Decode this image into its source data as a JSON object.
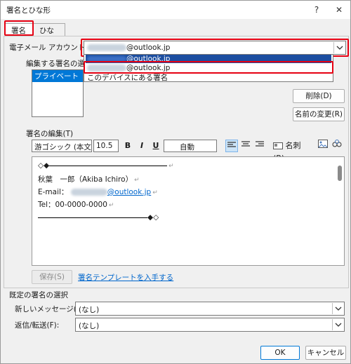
{
  "window": {
    "title": "署名とひな形",
    "help": "?",
    "close": "✕"
  },
  "tabs": [
    {
      "label": "署名"
    },
    {
      "label": "ひな形"
    }
  ],
  "account": {
    "label": "電子メール アカウント(A):",
    "value_suffix": "@outlook.jp",
    "dropdown_items": [
      "@outlook.jp",
      "@outlook.jp",
      "このデバイスにある署名"
    ]
  },
  "signature_select": {
    "label": "編集する署名の選択(",
    "items": [
      "プライベート"
    ]
  },
  "buttons": {
    "delete": "削除(D)",
    "rename": "名前の変更(R)",
    "save": "保存(S)",
    "ok": "OK",
    "cancel": "キャンセル",
    "business_card": "名刺(B)"
  },
  "editor": {
    "label": "署名の編集(T)",
    "font": "游ゴシック (本文の",
    "size": "10.5",
    "color": "自動",
    "lines": {
      "top": "◇◆",
      "name": "秋葉　一郎（Akiba Ichiro）",
      "email_label": "E-mail：",
      "email_domain": "@outlook.jp",
      "tel": "Tel：00-0000-0000",
      "bottom": "◆◇"
    },
    "return_mark": "↵"
  },
  "template_link": "署名テンプレートを入手する",
  "defaults": {
    "section_label": "既定の署名の選択",
    "new_message_label": "新しいメッセージ(M):",
    "new_message_value": "(なし)",
    "reply_label": "返信/転送(F):",
    "reply_value": "(なし)"
  },
  "colors": {
    "highlight_red": "#e60012",
    "selection_blue": "#0078d7",
    "link_blue": "#0066cc"
  }
}
